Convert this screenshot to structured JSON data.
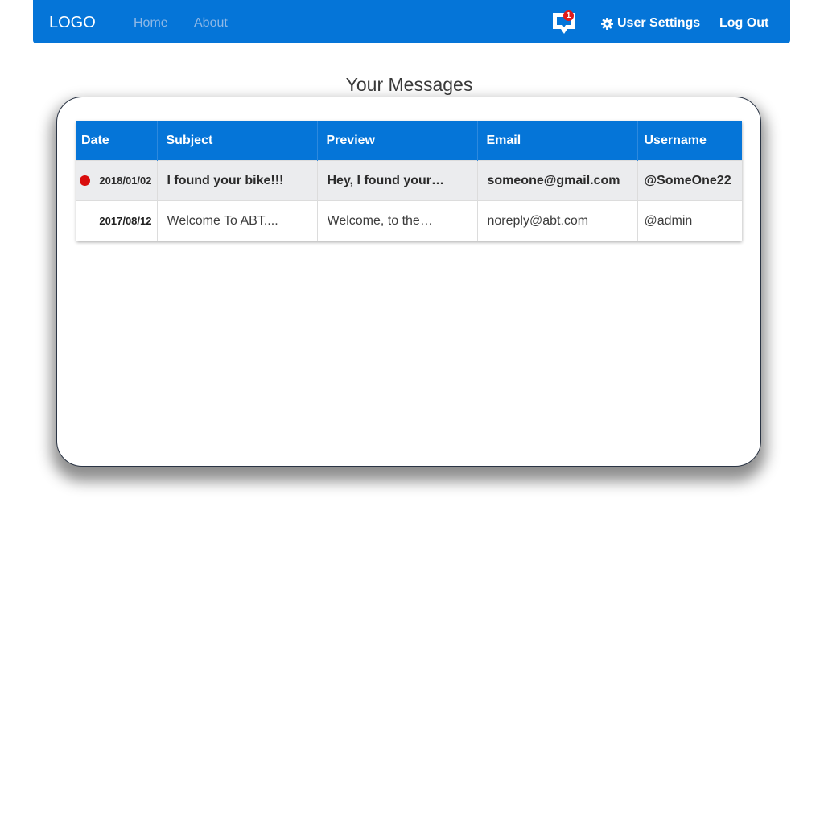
{
  "navbar": {
    "logo": "LOGO",
    "links": [
      "Home",
      "About"
    ],
    "message_badge": "1",
    "settings_label": "User Settings",
    "logout_label": "Log Out",
    "icons": {
      "messages": "chat-bubble-icon",
      "settings": "gear-icon"
    },
    "colors": {
      "background": "#0575d8",
      "badge": "#e01b1b"
    }
  },
  "page_title": "Your Messages",
  "table": {
    "headers": [
      "Date",
      "Subject",
      "Preview",
      "Email",
      "Username"
    ],
    "rows": [
      {
        "unread": true,
        "date": "2018/01/02",
        "subject": "I found your bike!!!",
        "preview": "Hey, I found your…",
        "email": "someone@gmail.com",
        "username": "@SomeOne22"
      },
      {
        "unread": false,
        "date": "2017/08/12",
        "subject": "Welcome To ABT....",
        "preview": "Welcome, to the…",
        "email": "noreply@abt.com",
        "username": "@admin"
      }
    ],
    "colors": {
      "header": "#0575d8",
      "unread_row": "#ebecee",
      "unread_dot": "#d90d0d"
    }
  }
}
